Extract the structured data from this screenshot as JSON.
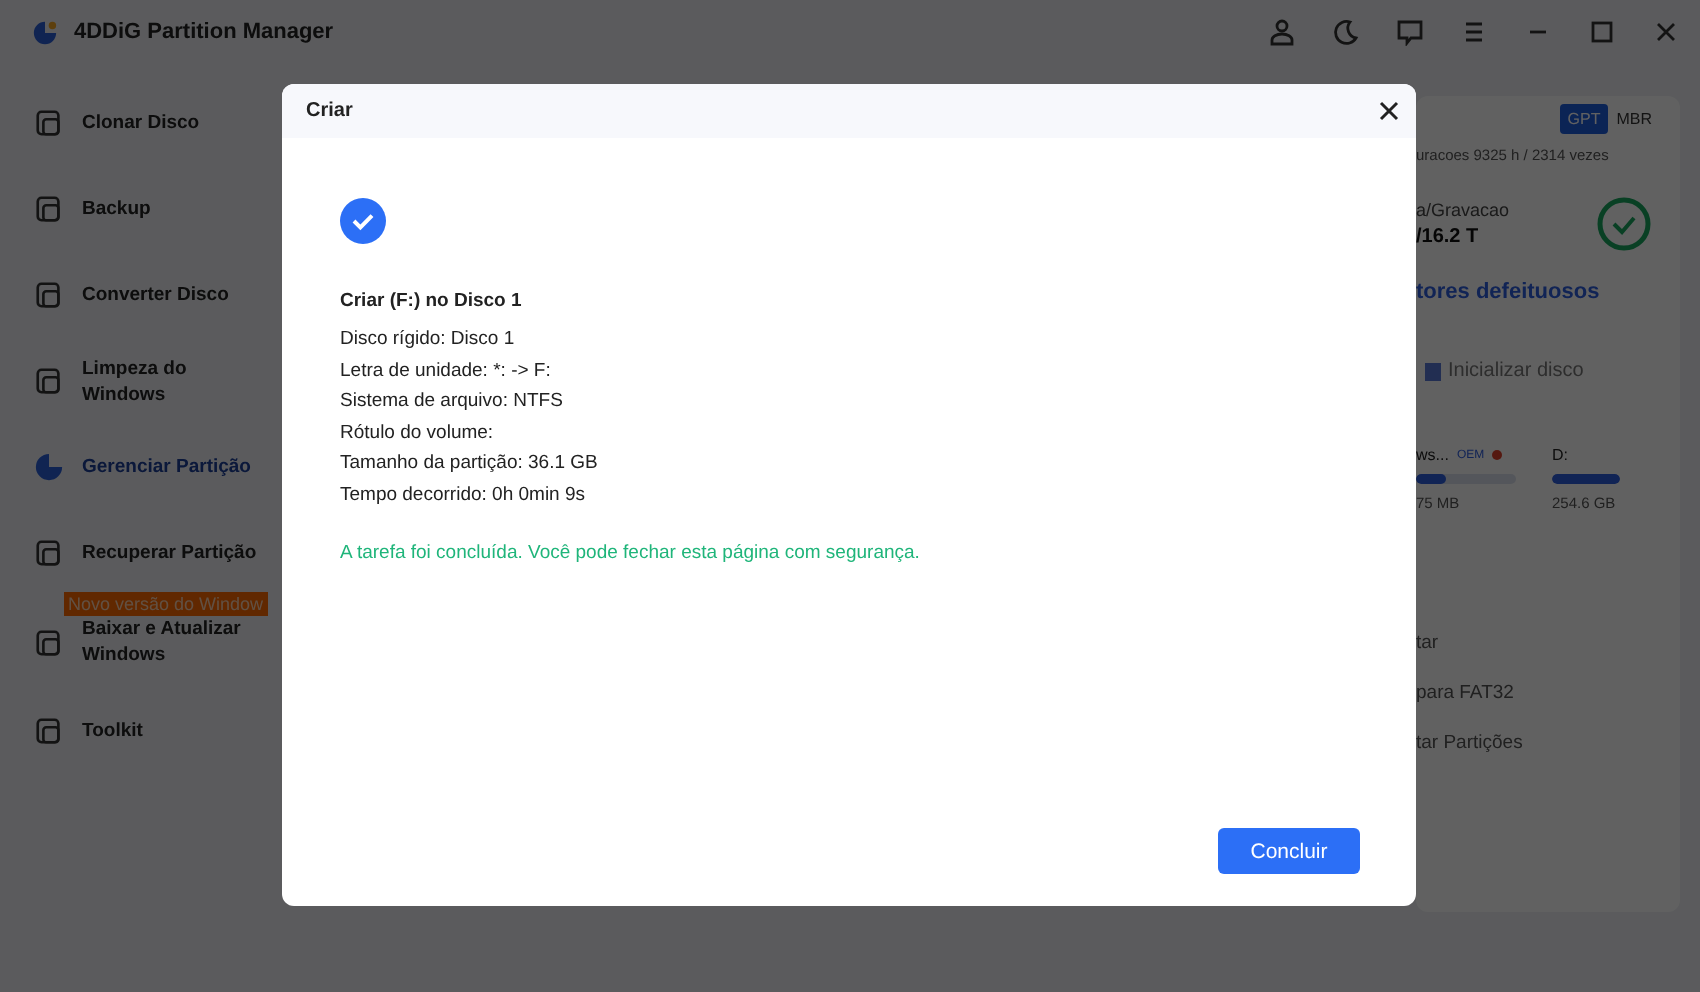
{
  "window": {
    "title": "4DDiG Partition Manager"
  },
  "sidebar": {
    "items": [
      {
        "label": "Clonar Disco",
        "selected": false
      },
      {
        "label": "Backup",
        "selected": false
      },
      {
        "label": "Converter Disco",
        "selected": false
      },
      {
        "label": "Limpeza do Windows",
        "selected": false
      },
      {
        "label": "Gerenciar Partição",
        "selected": true
      },
      {
        "label": "Recuperar Partição",
        "selected": false
      },
      {
        "label": "Baixar e Atualizar Windows",
        "selected": false,
        "badge": "Novo versão do Window"
      },
      {
        "label": "Toolkit",
        "selected": false
      }
    ]
  },
  "disk_panel": {
    "partition_styles": [
      {
        "label": "GPT",
        "selected": true
      },
      {
        "label": "MBR",
        "selected": false
      }
    ],
    "usage_text": "uracoes 9325 h / 2314 vezes",
    "read_write_label": "a/Gravacao",
    "read_write_value": "/16.2 T",
    "bad_sectors_link": "tores defeituosos",
    "init_button": "Inicializar disco",
    "partitions": [
      {
        "name": "ws...",
        "tag": "OEM",
        "size": "75 MB",
        "level": 0.3
      },
      {
        "name": "D:",
        "size": "254.6 GB",
        "level": 1
      }
    ],
    "actions": [
      "tar",
      "para FAT32",
      "tar Partições"
    ]
  },
  "dialog": {
    "title": "Criar",
    "heading": "Criar (F:) no Disco 1",
    "details": [
      "Disco rígido: Disco 1",
      "Letra de unidade: *: -> F:",
      "Sistema de arquivo: NTFS",
      "Rótulo do volume:",
      "Tamanho da partição: 36.1 GB",
      "Tempo decorrido: 0h 0min 9s"
    ],
    "message": "A tarefa foi concluída. Você pode fechar esta página com segurança.",
    "button": "Concluir"
  }
}
